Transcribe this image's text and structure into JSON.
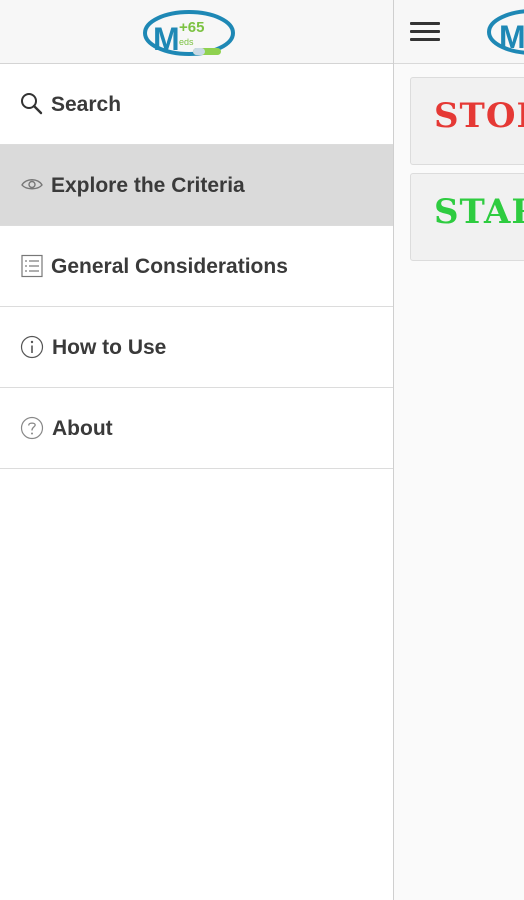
{
  "app": {
    "logo": {
      "letter": "M",
      "number": "+65",
      "small_text": "eds",
      "colors": {
        "ring": "#1e88b5",
        "letter": "#1e88b5",
        "number": "#7cc242",
        "pill": "#8fd14f"
      }
    }
  },
  "drawer": {
    "items": [
      {
        "label": "Search",
        "icon": "search-icon",
        "active": false
      },
      {
        "label": "Explore the Criteria",
        "icon": "eye-icon",
        "active": true
      },
      {
        "label": "General Considerations",
        "icon": "list-icon",
        "active": false
      },
      {
        "label": "How to Use",
        "icon": "info-icon",
        "active": false
      },
      {
        "label": "About",
        "icon": "help-icon",
        "active": false
      }
    ]
  },
  "main": {
    "cards": [
      {
        "label": "STOPP",
        "color": "#e53935"
      },
      {
        "label": "START",
        "color": "#2ecc40"
      }
    ]
  }
}
